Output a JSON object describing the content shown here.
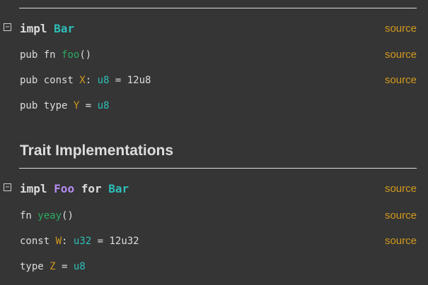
{
  "source_label": "source",
  "toggle_glyph": "−",
  "inherent": {
    "impl": {
      "kw_impl": "impl",
      "type": "Bar"
    },
    "items": [
      {
        "kw": "pub fn ",
        "name": "foo",
        "rest": "()"
      },
      {
        "kw": "pub const ",
        "name": "X",
        "sep": ": ",
        "type": "u8",
        "rest": " = 12u8"
      },
      {
        "kw": "pub type ",
        "name": "Y",
        "sep": " = ",
        "type": "u8"
      }
    ]
  },
  "trait_section": {
    "title": "Trait Implementations",
    "impl": {
      "kw_impl": "impl",
      "trait": "Foo",
      "kw_for": "for",
      "type": "Bar"
    },
    "items": [
      {
        "kw": "fn ",
        "name": "yeay",
        "rest": "()"
      },
      {
        "kw": "const ",
        "name": "W",
        "sep": ": ",
        "type": "u32",
        "rest": " = 12u32"
      },
      {
        "kw": "type ",
        "name": "Z",
        "sep": " = ",
        "type": "u8"
      }
    ]
  },
  "colors": {
    "background": "#353535",
    "text": "#dddddd",
    "type": "#2dbfb8",
    "trait": "#b78cf2",
    "function": "#2bab63",
    "constant": "#d2991d",
    "source_link": "#d2991d"
  }
}
